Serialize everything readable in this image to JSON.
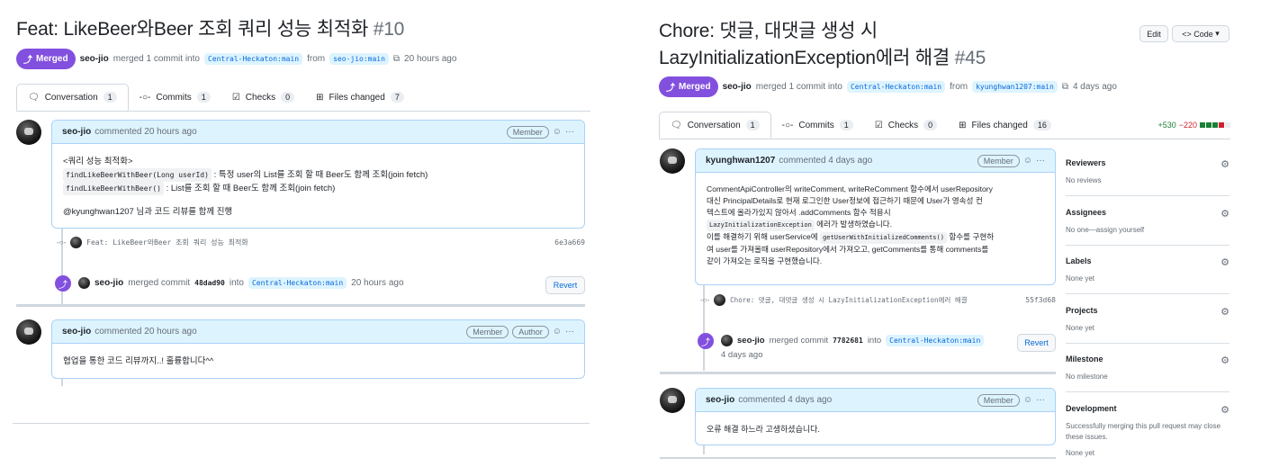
{
  "left": {
    "title": "Feat: LikeBeer와Beer 조회 쿼리 성능 최적화",
    "number": "#10",
    "status": "Merged",
    "author": "seo-jio",
    "merge_text": "merged 1 commit into",
    "base": "Central-Heckaton:main",
    "from": "from",
    "head": "seo-jio:main",
    "time": "20 hours ago",
    "tabs": [
      {
        "label": "Conversation",
        "count": "1"
      },
      {
        "label": "Commits",
        "count": "1"
      },
      {
        "label": "Checks",
        "count": "0"
      },
      {
        "label": "Files changed",
        "count": "7"
      }
    ],
    "c1": {
      "author": "seo-jio",
      "action": "commented 20 hours ago",
      "role": "Member",
      "l1": "<쿼리 성능 최적화>",
      "l2code": "findLikeBeerWithBeer(Long userId)",
      "l2": " : 특정 user의 List를 조회 할 때 Beer도 함께 조회(join fetch)",
      "l3code": "findLikeBeerWithBeer()",
      "l3": " : List를 조회 할 때 Beer도 함께 조회(join fetch)",
      "l4": "@kyunghwan1207 님과 코드 리뷰를 함께 진행"
    },
    "commit": {
      "msg": "Feat: LikeBeer와Beer 조회 쿼리 성능 최적화",
      "sha": "6e3a669"
    },
    "merge": {
      "author": "seo-jio",
      "text": "merged commit",
      "sha": "48dad90",
      "into": "into",
      "base": "Central-Heckaton:main",
      "time": "20 hours ago",
      "revert": "Revert"
    },
    "c2": {
      "author": "seo-jio",
      "action": "commented 20 hours ago",
      "role1": "Member",
      "role2": "Author",
      "body": "협업을 통한 코드 리뷰까지..! 훌륭합니다^^"
    }
  },
  "right": {
    "title1": "Chore: 댓글, 대댓글 생성 시",
    "title2": "LazyInitializationException에러 해결",
    "number": "#45",
    "edit": "Edit",
    "code": "Code",
    "status": "Merged",
    "author": "seo-jio",
    "merge_text": "merged 1 commit into",
    "base": "Central-Heckaton:main",
    "from": "from",
    "head": "kyunghwan1207:main",
    "time": "4 days ago",
    "tabs": [
      {
        "label": "Conversation",
        "count": "1"
      },
      {
        "label": "Commits",
        "count": "1"
      },
      {
        "label": "Checks",
        "count": "0"
      },
      {
        "label": "Files changed",
        "count": "16"
      }
    ],
    "diff_add": "+530",
    "diff_del": "−220",
    "c1": {
      "author": "kyunghwan1207",
      "action": "commented 4 days ago",
      "role": "Member",
      "l1": "CommentApiController의 writeComment, writeReComment 함수에서 userRepository",
      "l2": "대신 PrincipalDetails로 현재 로그인한 User정보에 접근하기 때문에 User가 영속성 컨",
      "l3": "텍스트에 올라가있지 않아서 .addComments 함수 적용시",
      "l4code": "LazyInitializationException",
      "l4": " 에러가 발생하였습니다.",
      "l5a": "이를 해결하기 위해 userService에 ",
      "l5code": "getUserWithInitializedComments()",
      "l5b": " 함수를 구현하",
      "l6": "여 user를 가져올때 userRepository에서 가져오고, getComments를 통해 comments를",
      "l7": "같이 가져오는 로직을 구현했습니다."
    },
    "commit": {
      "msg": "Chore: 댓글, 대댓글 생성 시 LazyInitializationException에러 해결",
      "sha": "55f3d68"
    },
    "merge": {
      "author": "seo-jio",
      "text": "merged commit",
      "sha": "7782681",
      "into": "into",
      "base": "Central-Heckaton:main",
      "time": "4 days ago",
      "revert": "Revert"
    },
    "c2": {
      "author": "seo-jio",
      "action": "commented 4 days ago",
      "role": "Member",
      "body": "오류 해결 하느라 고생하셨습니다."
    },
    "sidebar": [
      {
        "h": "Reviewers",
        "v": "No reviews"
      },
      {
        "h": "Assignees",
        "v": "No one—assign yourself"
      },
      {
        "h": "Labels",
        "v": "None yet"
      },
      {
        "h": "Projects",
        "v": "None yet"
      },
      {
        "h": "Milestone",
        "v": "No milestone"
      },
      {
        "h": "Development",
        "v": "Successfully merging this pull request may close these issues.",
        "v2": "None yet"
      }
    ]
  }
}
